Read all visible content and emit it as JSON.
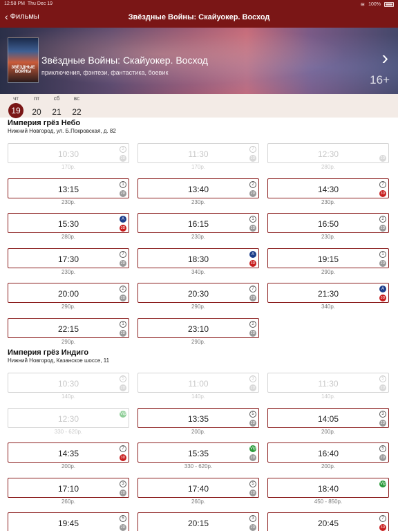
{
  "status": {
    "time": "12:58 PM",
    "date": "Thu Dec 19",
    "battery": "100%"
  },
  "nav": {
    "back_label": "Фильмы",
    "title": "Звёздные Войны: Скайуокер. Восход"
  },
  "movie": {
    "poster_text": "ЗВЁЗДНЫЕ ВОЙНЫ",
    "title": "Звёздные Войны: Скайуокер. Восход",
    "genres": "приключения, фэнтези, фантастика, боевик",
    "age": "16+"
  },
  "days": [
    {
      "weekday": "чт",
      "num": "19",
      "selected": true
    },
    {
      "weekday": "пт",
      "num": "20",
      "selected": false
    },
    {
      "weekday": "сб",
      "num": "21",
      "selected": false
    },
    {
      "weekday": "вс",
      "num": "22",
      "selected": false
    }
  ],
  "cinemas": [
    {
      "name": "Империя грёз Небо",
      "address": "Нижний Новгород, ул. Б.Покровская, д. 82",
      "sessions": [
        {
          "time": "10:30",
          "hall": "2",
          "format": "2D",
          "price": "170р.",
          "active": false
        },
        {
          "time": "11:30",
          "hall": "7",
          "format": "2D",
          "price": "170р.",
          "active": false
        },
        {
          "time": "12:30",
          "hall": "",
          "format": "2D",
          "price": "280р.",
          "active": false
        },
        {
          "time": "13:15",
          "hall": "1",
          "format": "2D",
          "price": "230р.",
          "active": true
        },
        {
          "time": "13:40",
          "hall": "2",
          "format": "2D",
          "price": "230р.",
          "active": true
        },
        {
          "time": "14:30",
          "hall": "7",
          "format": "3D",
          "price": "230р.",
          "active": true
        },
        {
          "time": "15:30",
          "hall": "A",
          "format": "3D",
          "price": "280р.",
          "active": true
        },
        {
          "time": "16:15",
          "hall": "1",
          "format": "2D",
          "price": "230р.",
          "active": true
        },
        {
          "time": "16:50",
          "hall": "2",
          "format": "2D",
          "price": "230р.",
          "active": true
        },
        {
          "time": "17:30",
          "hall": "7",
          "format": "2D",
          "price": "230р.",
          "active": true
        },
        {
          "time": "18:30",
          "hall": "A",
          "format": "3D",
          "price": "340р.",
          "active": true
        },
        {
          "time": "19:15",
          "hall": "1",
          "format": "2D",
          "price": "290р.",
          "active": true
        },
        {
          "time": "20:00",
          "hall": "2",
          "format": "2D",
          "price": "290р.",
          "active": true
        },
        {
          "time": "20:30",
          "hall": "7",
          "format": "2D",
          "price": "290р.",
          "active": true
        },
        {
          "time": "21:30",
          "hall": "A",
          "format": "3D",
          "price": "340р.",
          "active": true
        },
        {
          "time": "22:15",
          "hall": "1",
          "format": "2D",
          "price": "290р.",
          "active": true
        },
        {
          "time": "23:10",
          "hall": "2",
          "format": "2D",
          "price": "290р.",
          "active": true
        }
      ]
    },
    {
      "name": "Империя грёз Индиго",
      "address": "Нижний Новгород, Казанское шоссе, 11",
      "sessions": [
        {
          "time": "10:30",
          "hall": "5",
          "format": "2D",
          "price": "140р.",
          "active": false
        },
        {
          "time": "11:00",
          "hall": "3",
          "format": "2D",
          "price": "140р.",
          "active": false
        },
        {
          "time": "11:30",
          "hall": "5",
          "format": "2D",
          "price": "140р.",
          "active": false
        },
        {
          "time": "12:30",
          "hall": "Vip",
          "format": "",
          "price": "330 - 620р.",
          "active": false
        },
        {
          "time": "13:35",
          "hall": "5",
          "format": "2D",
          "price": "200р.",
          "active": true
        },
        {
          "time": "14:05",
          "hall": "3",
          "format": "2D",
          "price": "200р.",
          "active": true
        },
        {
          "time": "14:35",
          "hall": "7",
          "format": "3D",
          "price": "200р.",
          "active": true
        },
        {
          "time": "15:35",
          "hall": "Vip",
          "format": "2D",
          "price": "330 - 620р.",
          "active": true
        },
        {
          "time": "16:40",
          "hall": "5",
          "format": "2D",
          "price": "200р.",
          "active": true
        },
        {
          "time": "17:10",
          "hall": "3",
          "format": "2D",
          "price": "260р.",
          "active": true
        },
        {
          "time": "17:40",
          "hall": "5",
          "format": "2D",
          "price": "260р.",
          "active": true
        },
        {
          "time": "18:40",
          "hall": "Vip",
          "format": "",
          "price": "450 - 850р.",
          "active": true
        },
        {
          "time": "19:45",
          "hall": "5",
          "format": "2D",
          "price": "",
          "active": true
        },
        {
          "time": "20:15",
          "hall": "3",
          "format": "2D",
          "price": "",
          "active": true
        },
        {
          "time": "20:45",
          "hall": "7",
          "format": "3D",
          "price": "",
          "active": true
        }
      ]
    }
  ]
}
